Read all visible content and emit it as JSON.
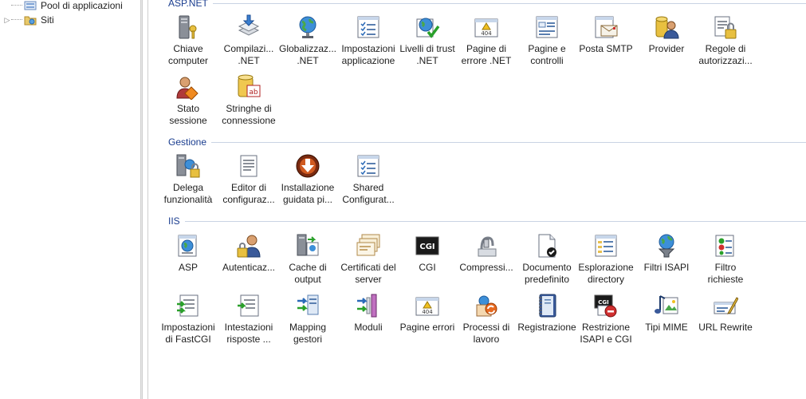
{
  "tree": [
    {
      "label": "Pool di applicazioni",
      "icon": "app-pool-icon"
    },
    {
      "label": "Siti",
      "icon": "sites-icon"
    }
  ],
  "groups": [
    {
      "title": "ASP.NET",
      "items": [
        {
          "label": "Chiave\ncomputer",
          "icon": "machine-key-icon"
        },
        {
          "label": "Compilazi...\n.NET",
          "icon": "compilation-icon"
        },
        {
          "label": "Globalizzaz...\n.NET",
          "icon": "globe-icon"
        },
        {
          "label": "Impostazioni\napplicazione",
          "icon": "app-settings-icon"
        },
        {
          "label": "Livelli di trust\n.NET",
          "icon": "trust-level-icon"
        },
        {
          "label": "Pagine di\nerrore .NET",
          "icon": "error-page-icon"
        },
        {
          "label": "Pagine e\ncontrolli",
          "icon": "pages-controls-icon"
        },
        {
          "label": "Posta SMTP",
          "icon": "smtp-mail-icon"
        },
        {
          "label": "Provider",
          "icon": "provider-icon"
        },
        {
          "label": "Regole di\nautorizzazi...",
          "icon": "authorization-rules-icon"
        },
        {
          "label": "Stato\nsessione",
          "icon": "session-state-icon"
        },
        {
          "label": "Stringhe di\nconnessione",
          "icon": "connection-strings-icon"
        }
      ]
    },
    {
      "title": "Gestione",
      "items": [
        {
          "label": "Delega\nfunzionalità",
          "icon": "feature-delegation-icon"
        },
        {
          "label": "Editor di\nconfiguraz...",
          "icon": "config-editor-icon"
        },
        {
          "label": "Installazione\nguidata pi...",
          "icon": "platform-installer-icon"
        },
        {
          "label": "Shared\nConfigurat...",
          "icon": "shared-config-icon"
        }
      ]
    },
    {
      "title": "IIS",
      "items": [
        {
          "label": "ASP",
          "icon": "asp-icon"
        },
        {
          "label": "Autenticaz...",
          "icon": "authentication-icon"
        },
        {
          "label": "Cache di\noutput",
          "icon": "output-cache-icon"
        },
        {
          "label": "Certificati del\nserver",
          "icon": "server-certificates-icon"
        },
        {
          "label": "CGI",
          "icon": "cgi-icon"
        },
        {
          "label": "Compressi...",
          "icon": "compression-icon"
        },
        {
          "label": "Documento\npredefinito",
          "icon": "default-document-icon"
        },
        {
          "label": "Esplorazione\ndirectory",
          "icon": "directory-browsing-icon"
        },
        {
          "label": "Filtri ISAPI",
          "icon": "isapi-filters-icon"
        },
        {
          "label": "Filtro\nrichieste",
          "icon": "request-filtering-icon"
        },
        {
          "label": "Impostazioni\ndi FastCGI",
          "icon": "fastcgi-settings-icon"
        },
        {
          "label": "Intestazioni\nrisposte ...",
          "icon": "response-headers-icon"
        },
        {
          "label": "Mapping\ngestori",
          "icon": "handler-mappings-icon"
        },
        {
          "label": "Moduli",
          "icon": "modules-icon"
        },
        {
          "label": "Pagine errori",
          "icon": "error-pages-icon"
        },
        {
          "label": "Processi di\nlavoro",
          "icon": "worker-processes-icon"
        },
        {
          "label": "Registrazione",
          "icon": "logging-icon"
        },
        {
          "label": "Restrizione\nISAPI e CGI",
          "icon": "isapi-cgi-restrictions-icon"
        },
        {
          "label": "Tipi MIME",
          "icon": "mime-types-icon"
        },
        {
          "label": "URL Rewrite",
          "icon": "url-rewrite-icon"
        }
      ]
    }
  ]
}
